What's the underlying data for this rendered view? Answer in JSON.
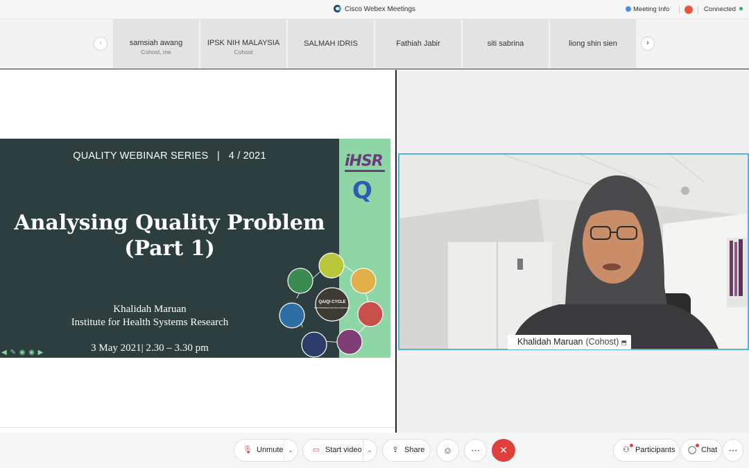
{
  "titlebar": {
    "app_title": "Cisco Webex Meetings",
    "meeting_info": "Meeting Info",
    "connection_status": "Connected"
  },
  "participants": [
    {
      "name": "samsiah awang",
      "role": "Cohost, me"
    },
    {
      "name": "IPSK NIH MALAYSIA",
      "role": "Cohost"
    },
    {
      "name": "SALMAH IDRIS",
      "role": ""
    },
    {
      "name": "Fathiah Jabir",
      "role": ""
    },
    {
      "name": "siti sabrina",
      "role": ""
    },
    {
      "name": "liong shin sien",
      "role": ""
    }
  ],
  "slide": {
    "series": "QUALITY WEBINAR SERIES   |   4 / 2021",
    "title_line1": "Analysing Quality Problem",
    "title_line2": "(Part 1)",
    "author": "Khalidah Maruan",
    "institute": "Institute for Health Systems Research",
    "date": "3 May 2021|  2.30 – 3.30 pm",
    "logo_text": "iHSR",
    "q_logo": "Q",
    "cycle_center": "QA/QI CYCLE",
    "cycle_sub": "THE PROBLEM SOLVING APPROACH"
  },
  "video": {
    "speaker_name": "Khalidah Maruan",
    "speaker_role": "(Cohost)"
  },
  "controls": {
    "unmute": "Unmute",
    "start_video": "Start video",
    "share": "Share",
    "participants": "Participants",
    "chat": "Chat"
  },
  "icons": {
    "mic": "mic-muted-icon",
    "video": "video-off-icon",
    "share": "share-icon",
    "reactions": "emoji-icon",
    "more": "more-icon",
    "end": "end-call-icon",
    "participants": "participants-icon",
    "chat": "chat-icon"
  },
  "colors": {
    "end_call": "#e0403d",
    "active_speaker_border": "#4fb4e4",
    "slide_bg": "#2c3e3d",
    "slide_accent": "#8fd6a6"
  }
}
